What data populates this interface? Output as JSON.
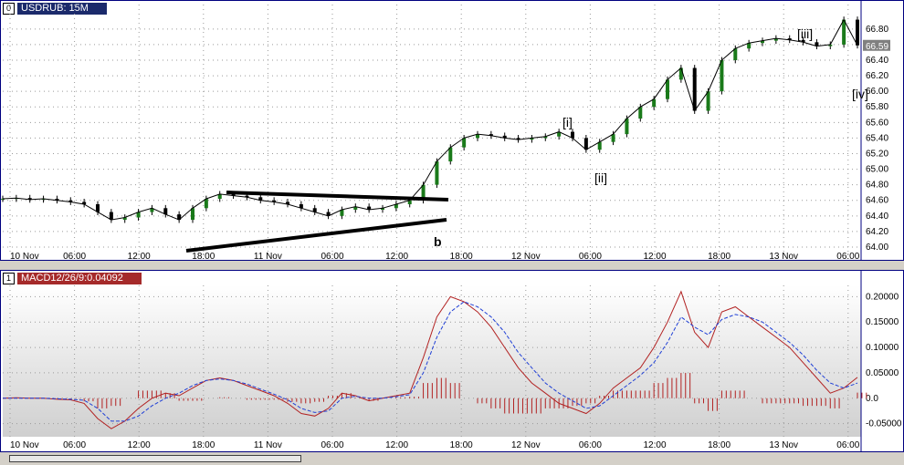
{
  "window": {
    "price_pane_index": "0",
    "price_pane_title": "USDRUB: 15M",
    "macd_pane_index": "1",
    "macd_pane_title": "MACD12/26/9:0.04092"
  },
  "colors": {
    "grid": "#9a9a9a",
    "candle": "#000000",
    "candle_up": "#1a7a1a",
    "macd_line": "#b22222",
    "signal_line": "#1f3fd6",
    "histogram": "#b22222",
    "price_tag_bg": "#808080",
    "trendline": "#000000"
  },
  "chart_data": [
    {
      "type": "line",
      "name": "price",
      "x_labels": [
        "10 Nov",
        "06:00",
        "12:00",
        "18:00",
        "11 Nov",
        "06:00",
        "12:00",
        "18:00",
        "12 Nov",
        "06:00",
        "12:00",
        "18:00",
        "13 Nov",
        "06:00"
      ],
      "y_ticks": [
        "66.80",
        "66.60",
        "66.40",
        "66.20",
        "66.00",
        "65.80",
        "65.60",
        "65.40",
        "65.20",
        "65.00",
        "64.80",
        "64.60",
        "64.40",
        "64.20",
        "64.00"
      ],
      "ylim": [
        64.0,
        66.95
      ],
      "last_price": "66.59",
      "annotations": [
        "b",
        "[i]",
        "[ii]",
        "[iii]",
        "[iv]"
      ],
      "points": [
        [
          0,
          64.62
        ],
        [
          1,
          64.63
        ],
        [
          2,
          64.61
        ],
        [
          3,
          64.62
        ],
        [
          4,
          64.6
        ],
        [
          5,
          64.58
        ],
        [
          6,
          64.55
        ],
        [
          7,
          64.45
        ],
        [
          8,
          64.35
        ],
        [
          9,
          64.38
        ],
        [
          10,
          64.45
        ],
        [
          11,
          64.5
        ],
        [
          12,
          64.42
        ],
        [
          13,
          64.35
        ],
        [
          14,
          64.5
        ],
        [
          15,
          64.62
        ],
        [
          16,
          64.68
        ],
        [
          17,
          64.66
        ],
        [
          18,
          64.64
        ],
        [
          19,
          64.6
        ],
        [
          20,
          64.58
        ],
        [
          21,
          64.55
        ],
        [
          22,
          64.5
        ],
        [
          23,
          64.45
        ],
        [
          24,
          64.4
        ],
        [
          25,
          64.48
        ],
        [
          26,
          64.52
        ],
        [
          27,
          64.48
        ],
        [
          28,
          64.5
        ],
        [
          29,
          64.55
        ],
        [
          30,
          64.6
        ],
        [
          31,
          64.8
        ],
        [
          32,
          65.1
        ],
        [
          33,
          65.28
        ],
        [
          34,
          65.4
        ],
        [
          35,
          65.45
        ],
        [
          36,
          65.43
        ],
        [
          37,
          65.4
        ],
        [
          38,
          65.38
        ],
        [
          39,
          65.4
        ],
        [
          40,
          65.42
        ],
        [
          41,
          65.48
        ],
        [
          42,
          65.4
        ],
        [
          43,
          65.25
        ],
        [
          44,
          65.35
        ],
        [
          45,
          65.45
        ],
        [
          46,
          65.65
        ],
        [
          47,
          65.8
        ],
        [
          48,
          65.9
        ],
        [
          49,
          66.15
        ],
        [
          50,
          66.3
        ],
        [
          51,
          65.75
        ],
        [
          52,
          66.0
        ],
        [
          53,
          66.4
        ],
        [
          54,
          66.55
        ],
        [
          55,
          66.62
        ],
        [
          56,
          66.65
        ],
        [
          57,
          66.68
        ],
        [
          58,
          66.66
        ],
        [
          59,
          66.63
        ],
        [
          60,
          66.58
        ],
        [
          61,
          66.6
        ],
        [
          62,
          66.92
        ],
        [
          63,
          66.59
        ]
      ],
      "x_range": [
        0,
        63
      ]
    },
    {
      "type": "line",
      "name": "macd",
      "y_ticks": [
        "0.20000",
        "0.15000",
        "0.10000",
        "0.05000",
        "0.0",
        "-0.05000"
      ],
      "ylim": [
        -0.065,
        0.215
      ],
      "series": [
        {
          "name": "MACD",
          "values": [
            0.0,
            0.001,
            0.0,
            0.0,
            -0.002,
            -0.003,
            -0.01,
            -0.04,
            -0.06,
            -0.045,
            -0.02,
            0.0,
            0.01,
            0.005,
            0.02,
            0.035,
            0.04,
            0.035,
            0.025,
            0.015,
            0.005,
            -0.01,
            -0.03,
            -0.035,
            -0.02,
            0.01,
            0.005,
            -0.005,
            0.0,
            0.005,
            0.01,
            0.08,
            0.16,
            0.2,
            0.19,
            0.17,
            0.14,
            0.1,
            0.06,
            0.03,
            0.01,
            -0.01,
            -0.02,
            -0.03,
            -0.01,
            0.02,
            0.04,
            0.06,
            0.1,
            0.15,
            0.21,
            0.13,
            0.1,
            0.17,
            0.18,
            0.16,
            0.14,
            0.12,
            0.1,
            0.07,
            0.04,
            0.01,
            0.02,
            0.041
          ]
        },
        {
          "name": "Signal",
          "values": [
            0.0,
            0.0,
            0.0,
            0.0,
            -0.001,
            -0.002,
            -0.004,
            -0.02,
            -0.045,
            -0.045,
            -0.035,
            -0.015,
            0.0,
            0.01,
            0.025,
            0.035,
            0.038,
            0.035,
            0.028,
            0.018,
            0.008,
            -0.003,
            -0.02,
            -0.028,
            -0.025,
            0.0,
            0.004,
            0.0,
            0.0,
            0.003,
            0.007,
            0.05,
            0.12,
            0.17,
            0.19,
            0.18,
            0.16,
            0.13,
            0.09,
            0.06,
            0.03,
            0.01,
            -0.005,
            -0.02,
            -0.015,
            0.005,
            0.025,
            0.045,
            0.07,
            0.11,
            0.16,
            0.14,
            0.125,
            0.155,
            0.165,
            0.16,
            0.15,
            0.13,
            0.11,
            0.085,
            0.055,
            0.03,
            0.02,
            0.03
          ]
        }
      ],
      "histogram": [
        0.0,
        0.001,
        0.0,
        0.0,
        -0.001,
        -0.001,
        -0.006,
        -0.02,
        -0.015,
        0.0,
        0.015,
        0.015,
        0.01,
        -0.005,
        -0.005,
        0.0,
        0.002,
        0.0,
        -0.003,
        -0.003,
        -0.003,
        -0.007,
        -0.01,
        -0.007,
        0.005,
        0.01,
        0.001,
        -0.005,
        0.0,
        0.002,
        0.003,
        0.03,
        0.04,
        0.03,
        0.0,
        -0.01,
        -0.02,
        -0.03,
        -0.03,
        -0.03,
        -0.02,
        -0.02,
        -0.015,
        -0.01,
        0.005,
        0.015,
        0.015,
        0.015,
        0.03,
        0.04,
        0.05,
        -0.01,
        -0.025,
        0.015,
        0.015,
        0.0,
        -0.01,
        -0.01,
        -0.01,
        -0.015,
        -0.015,
        -0.02,
        0.0,
        0.011
      ]
    }
  ]
}
